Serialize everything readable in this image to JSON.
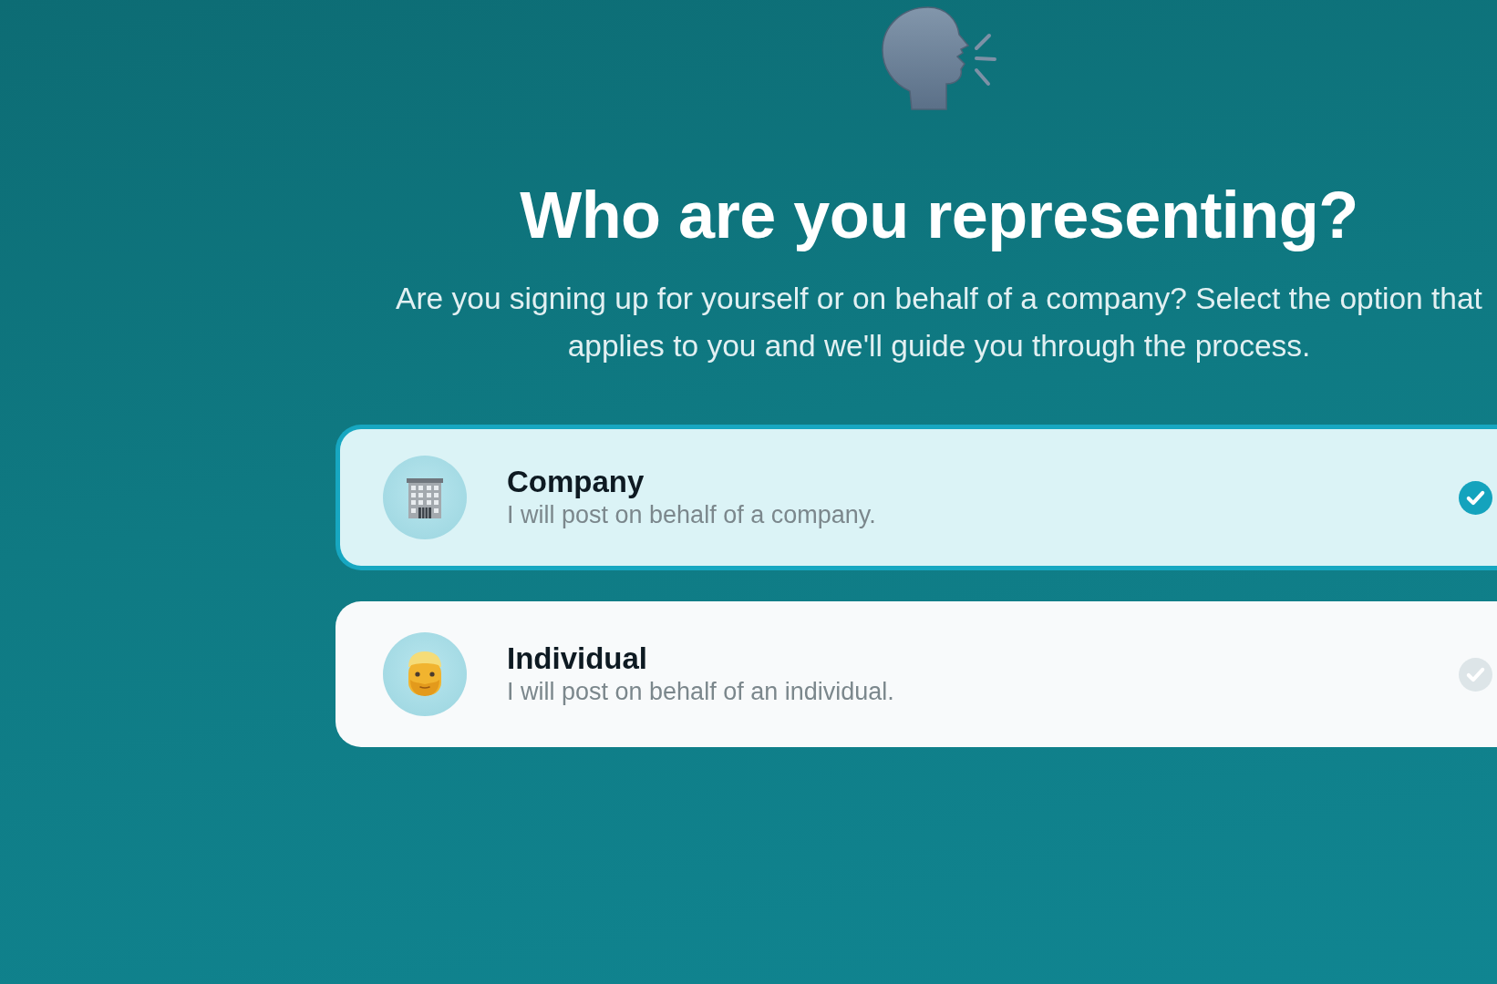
{
  "header": {
    "title": "Who are you representing?",
    "subtitle": "Are you signing up for yourself or on behalf of a company? Select the option that applies to you and we'll guide you through the process."
  },
  "options": [
    {
      "kind": "company",
      "label": "Company",
      "description": "I will post on behalf of a company.",
      "selected": true
    },
    {
      "kind": "individual",
      "label": "Individual",
      "description": "I will post on behalf of an individual.",
      "selected": false
    }
  ]
}
